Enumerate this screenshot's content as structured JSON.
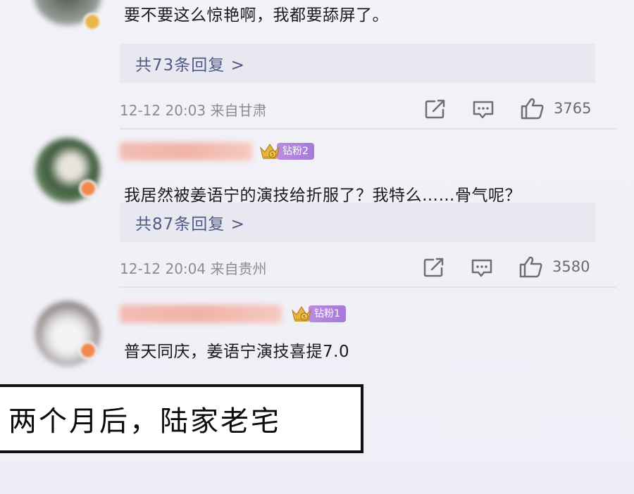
{
  "comments": [
    {
      "text": "要不要这么惊艳啊，我都要舔屏了。",
      "reply_label": "共73条回复 >",
      "time_location": "12-12 20:03 来自甘肃",
      "likes": "3765"
    },
    {
      "badge": "钻粉2",
      "text": "我居然被姜语宁的演技给折服了？我特么……骨气呢？",
      "reply_label": "共87条回复 >",
      "time_location": "12-12 20:04 来自贵州",
      "likes": "3580"
    },
    {
      "badge": "钻粉1",
      "text": "普天同庆，姜语宁演技喜提7.0"
    }
  ],
  "caption": "两个月后，陆家老宅",
  "icons": {
    "share": "share-icon",
    "comment": "comment-icon",
    "like": "thumbs-up-icon",
    "crown": "crown-icon"
  },
  "colors": {
    "reply_text": "#4e5b87",
    "badge": "#a67ad8",
    "meta": "#8b8b92"
  }
}
